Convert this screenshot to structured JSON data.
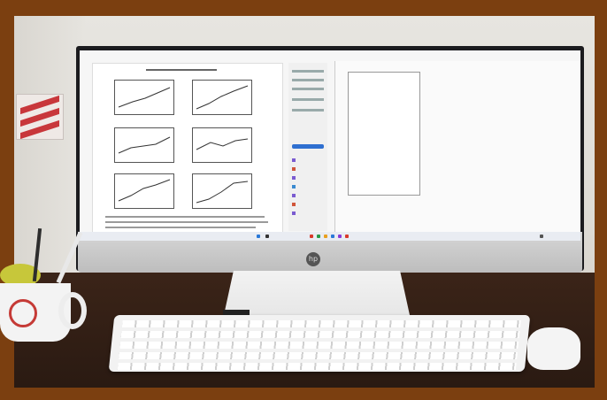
{
  "scene": {
    "monitor_brand_logo": "hp-logo",
    "icons": [
      "hp-logo",
      "keyboard",
      "mouse",
      "mug",
      "monitor"
    ]
  },
  "colors": {
    "border": "#7b3f10",
    "desk": "#2f1c13",
    "screen": "#f6f6f6",
    "accent_blue": "#2f6fd0"
  }
}
